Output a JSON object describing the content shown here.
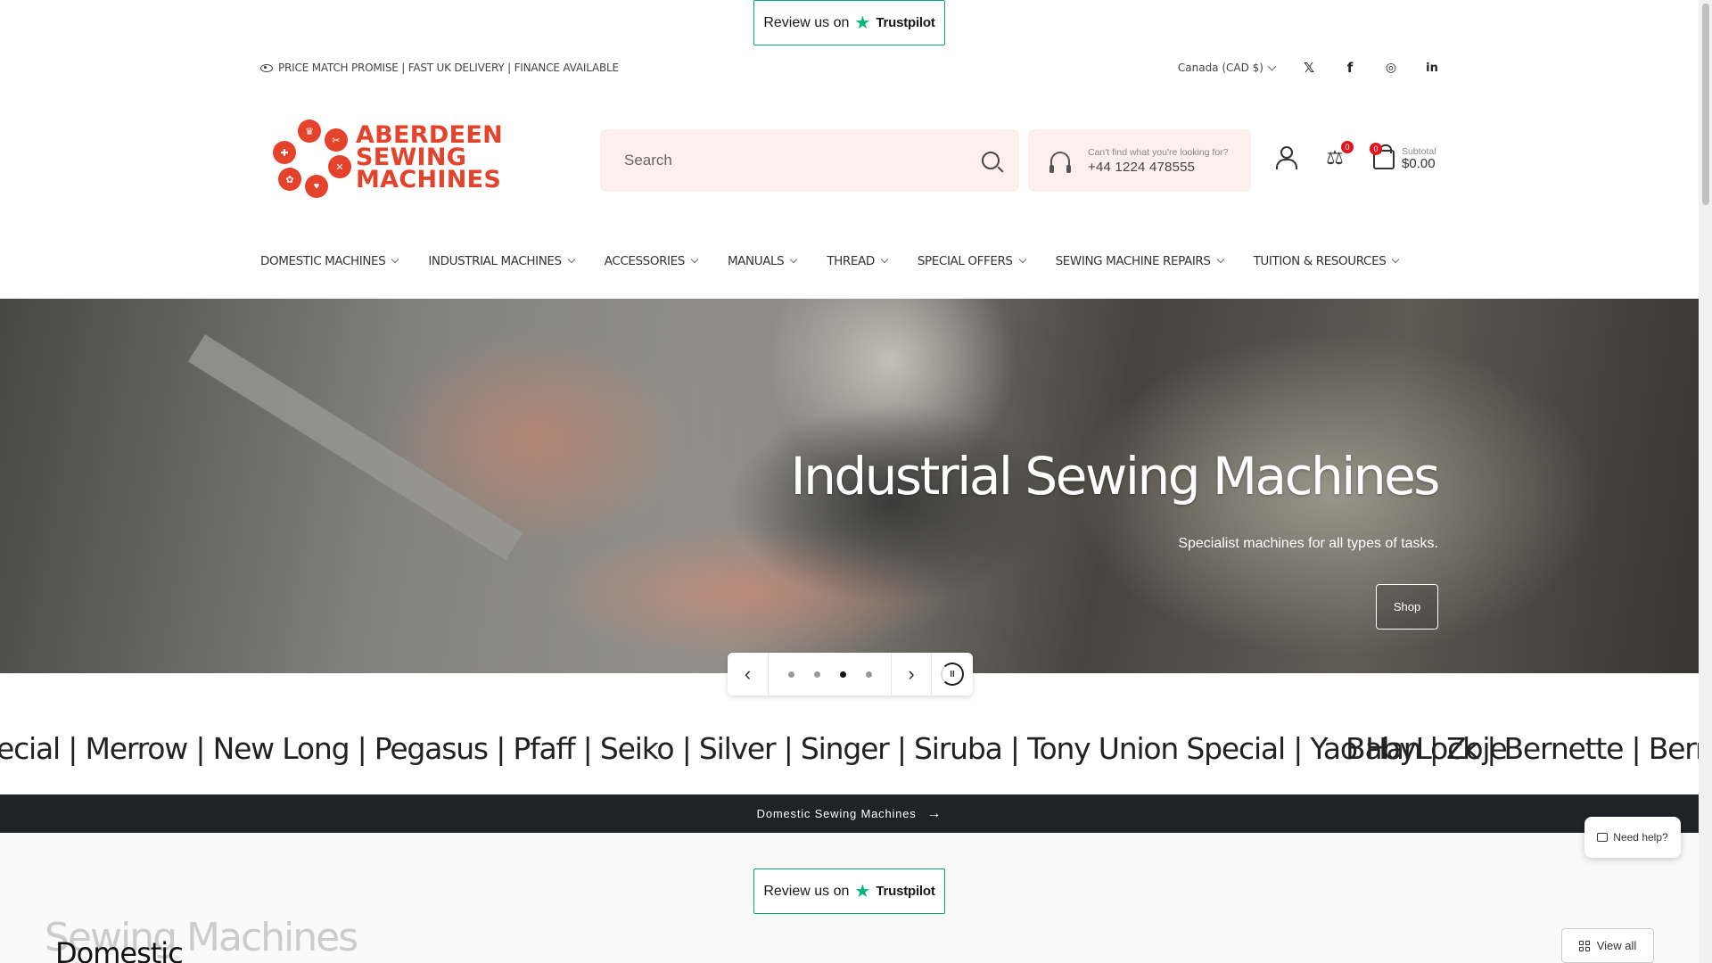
{
  "trustpilot": {
    "label": "Review us on",
    "brand": "Trustpilot"
  },
  "topbar": {
    "promo": "PRICE MATCH PROMISE | FAST UK DELIVERY | FINANCE AVAILABLE",
    "currency": "Canada (CAD $)",
    "social_icons": [
      "x-icon",
      "facebook-icon",
      "instagram-icon",
      "linkedin-icon"
    ]
  },
  "logo": {
    "line1": "ABERDEEN",
    "line2": "SEWING",
    "line3": "MACHINES",
    "color": "#e4422a"
  },
  "search": {
    "placeholder": "Search"
  },
  "help": {
    "label": "Can't find what you're looking for?",
    "phone": "+44 1224 478555"
  },
  "header_icons": {
    "compare_count": "0",
    "cart_count": "0",
    "subtotal_label": "Subtotal",
    "subtotal_value": "$0.00"
  },
  "nav": [
    {
      "label": "DOMESTIC MACHINES"
    },
    {
      "label": "INDUSTRIAL MACHINES"
    },
    {
      "label": "ACCESSORIES"
    },
    {
      "label": "MANUALS"
    },
    {
      "label": "THREAD"
    },
    {
      "label": "SPECIAL OFFERS"
    },
    {
      "label": "SEWING MACHINE REPAIRS"
    },
    {
      "label": "TUITION & RESOURCES"
    }
  ],
  "hero": {
    "title": "Industrial Sewing Machines",
    "subtitle": "Specialist machines for all types of tasks.",
    "button": "Shop",
    "active_slide": 3,
    "slide_count": 4
  },
  "marquee": {
    "part1": "ecial | Merrow | New Long | Pegasus | Pfaff | Seiko | Silver | Singer | Siruba | Tony Union Special | Yao Han | Zoje",
    "part2": "BabyLock | Bernette | Bernina"
  },
  "dark_bar": {
    "label": "Domestic Sewing Machines"
  },
  "need_help": {
    "label": "Need help?"
  },
  "section": {
    "title": "Sewing Machines",
    "subtitle": "Domestic",
    "view_all": "View all"
  },
  "colors": {
    "accent": "#e4422a",
    "trustpilot": "#00b67a",
    "search_bg": "#fcefed",
    "dark_bar": "#1f2326",
    "badge": "#e4151f"
  }
}
